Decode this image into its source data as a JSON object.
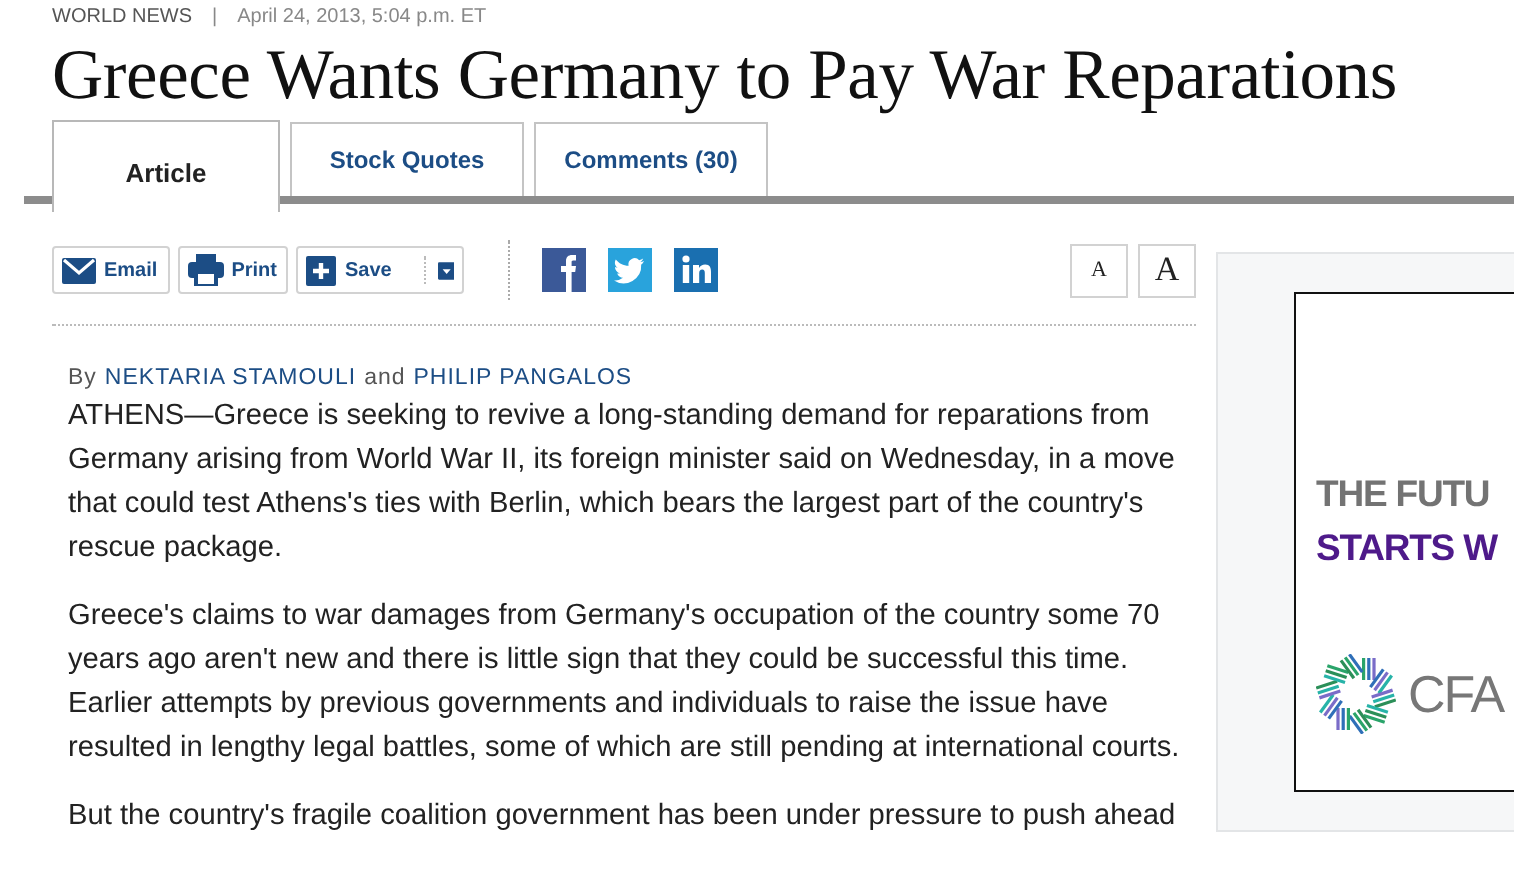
{
  "section": "WORLD NEWS",
  "separator": "|",
  "timestamp": "April 24, 2013, 5:04 p.m. ET",
  "headline": "Greece Wants Germany to Pay War Reparations",
  "tabs": [
    {
      "label": "Article",
      "selected": true
    },
    {
      "label": "Stock Quotes",
      "selected": false
    },
    {
      "label": "Comments (30)",
      "selected": false
    }
  ],
  "toolbar": {
    "buttons": [
      {
        "kind": "email",
        "label": "Email"
      },
      {
        "kind": "print",
        "label": "Print"
      },
      {
        "kind": "save",
        "label": "Save"
      }
    ],
    "social": [
      {
        "kind": "facebook"
      },
      {
        "kind": "twitter"
      },
      {
        "kind": "linkedin"
      }
    ],
    "text_size": [
      "A",
      "A"
    ]
  },
  "byline": {
    "prefix": "By",
    "authors": [
      "NEKTARIA STAMOULI",
      "PHILIP PANGALOS"
    ],
    "joiner": "and"
  },
  "paragraphs": [
    "ATHENS—Greece is seeking to revive a long-standing demand for reparations from Germany arising from World War II, its foreign minister said on Wednesday, in a move that could test Athens's ties with Berlin, which bears the largest part of the country's rescue package.",
    "Greece's claims to war damages from Germany's occupation of the country some 70 years ago aren't new and there is little sign that they could be successful this time. Earlier attempts by previous governments and individuals to raise the issue have resulted in lengthy legal battles, some of which are still pending at international courts.",
    "But the country's fragile coalition government has been under pressure to push ahead"
  ],
  "ad": {
    "lines": [
      {
        "text": "THE FUTU",
        "color": "#737373"
      },
      {
        "text": "STARTS W",
        "color": "#4e1a8a"
      }
    ],
    "brand": "CFA"
  }
}
